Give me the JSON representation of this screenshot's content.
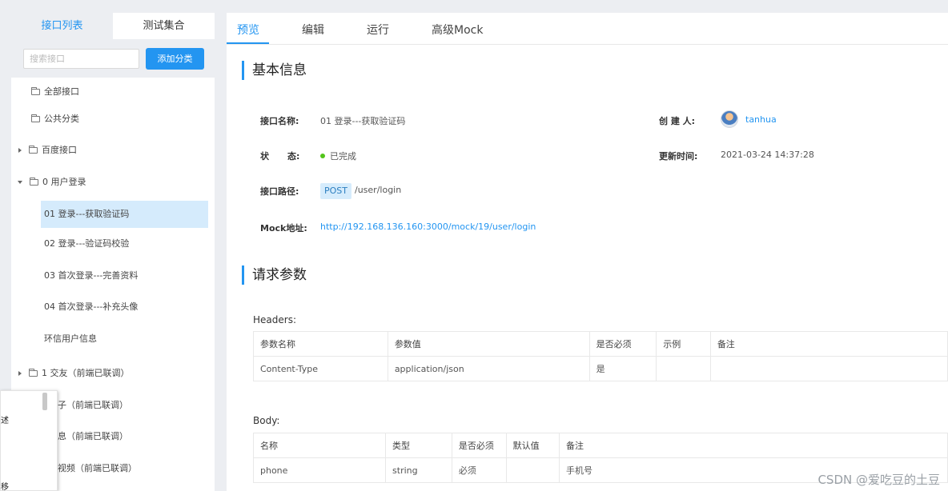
{
  "sidebar": {
    "tabs": [
      "接口列表",
      "测试集合"
    ],
    "search_placeholder": "搜索接口",
    "add_category_label": "添加分类",
    "tree": [
      {
        "label": "全部接口"
      },
      {
        "label": "公共分类"
      },
      {
        "label": "百度接口"
      },
      {
        "label": "0 用户登录"
      }
    ],
    "interfaces": [
      {
        "label": "01 登录---获取验证码",
        "selected": true
      },
      {
        "label": "02 登录---验证码校验"
      },
      {
        "label": "03 首次登录---完善资料"
      },
      {
        "label": "04 首次登录---补充头像"
      },
      {
        "label": "环信用户信息"
      }
    ],
    "more_categories": [
      {
        "label": "1 交友（前端已联调）"
      },
      {
        "label": "圈子（前端已联调）"
      },
      {
        "label": "消息（前端已联调）"
      },
      {
        "label": "小视频（前端已联调）"
      }
    ]
  },
  "popup": {
    "line1": "述",
    "line2": "移"
  },
  "tabs": [
    "预览",
    "编辑",
    "运行",
    "高级Mock"
  ],
  "basic_info": {
    "title": "基本信息",
    "name_label": "接口名称:",
    "name_value": "01 登录---获取验证码",
    "creator_label": "创 建 人:",
    "creator_value": "tanhua",
    "status_label": "状      态:",
    "status_value": "已完成",
    "updated_label": "更新时间:",
    "updated_value": "2021-03-24 14:37:28",
    "path_label": "接口路径:",
    "method": "POST",
    "path_value": "/user/login",
    "mock_label": "Mock地址:",
    "mock_value": "http://192.168.136.160:3000/mock/19/user/login"
  },
  "request_params": {
    "title": "请求参数",
    "headers_label": "Headers:",
    "headers_columns": [
      "参数名称",
      "参数值",
      "是否必须",
      "示例",
      "备注"
    ],
    "headers_rows": [
      [
        "Content-Type",
        "application/json",
        "是",
        "",
        ""
      ]
    ],
    "body_label": "Body:",
    "body_columns": [
      "名称",
      "类型",
      "是否必须",
      "默认值",
      "备注"
    ],
    "body_rows": [
      [
        "phone",
        "string",
        "必须",
        "",
        "手机号"
      ]
    ]
  },
  "watermark": "CSDN @爱吃豆的土豆",
  "colors": {
    "accent": "#2395f1",
    "status_done": "#52c41a",
    "selected_bg": "#d5ebfc"
  }
}
